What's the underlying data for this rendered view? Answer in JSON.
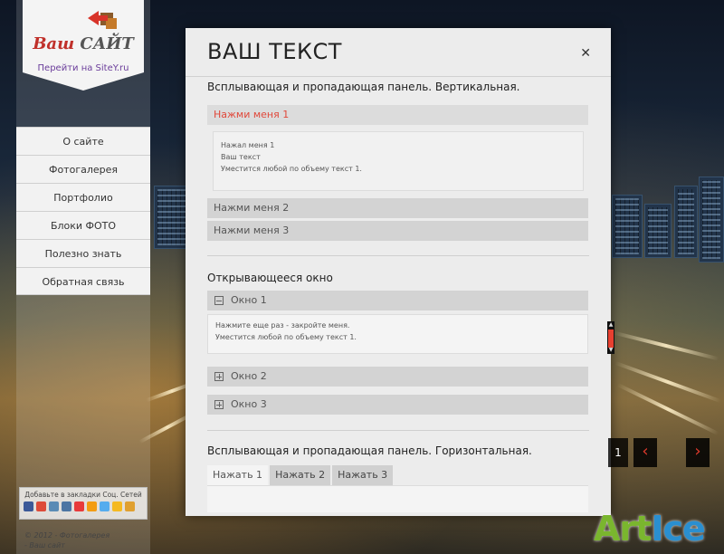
{
  "logo": {
    "title_part1": "Ваш ",
    "title_part2": "САЙТ",
    "link": "Перейти на SiteY.ru"
  },
  "menu": [
    {
      "label": "О сайте"
    },
    {
      "label": "Фотогалерея"
    },
    {
      "label": "Портфолио"
    },
    {
      "label": "Блоки ФОТО"
    },
    {
      "label": "Полезно знать"
    },
    {
      "label": "Обратная связь"
    }
  ],
  "bookmarks": {
    "label": "Добавьте в закладки Соц. Сетей",
    "icons": [
      "facebook-icon",
      "google-icon",
      "livejournal-icon",
      "vkontakte-icon",
      "moimir-icon",
      "odnoklassniki-icon",
      "twitter-icon",
      "yandex-icon",
      "bobrdobr-icon"
    ],
    "icon_colors": [
      "#3b5998",
      "#dd4b39",
      "#5a8bb5",
      "#4c75a3",
      "#e83a3a",
      "#f39c12",
      "#55acee",
      "#f5b921",
      "#e0a030"
    ]
  },
  "footer": {
    "line1": "© 2012 - Фотогалерея",
    "line2": "- Ваш сайт"
  },
  "modal": {
    "title": "ВАШ ТЕКСТ",
    "close": "✕",
    "section1_title": "Всплывающая и пропадающая панель. Вертикальная.",
    "accordion": [
      {
        "label": "Нажми меня 1",
        "active": true
      },
      {
        "label": "Нажми меня 2",
        "active": false
      },
      {
        "label": "Нажми меня 3",
        "active": false
      }
    ],
    "accordion_content": {
      "line1": "Нажал меня 1",
      "line2": "Ваш текст",
      "line3": "Уместится любой по объему текст 1."
    },
    "section2_title": "Открывающееся окно",
    "windows": [
      {
        "label": "Окно 1",
        "open": true
      },
      {
        "label": "Окно 2",
        "open": false
      },
      {
        "label": "Окно 3",
        "open": false
      }
    ],
    "window_content": {
      "line1": "Нажмите еще раз - закройте меня.",
      "line2": "Уместится любой по объему текст 1."
    },
    "section3_title": "Всплывающая и пропадающая панель. Горизонтальная.",
    "tabs": [
      {
        "label": "Нажать 1",
        "active": true
      },
      {
        "label": "Нажать 2",
        "active": false
      },
      {
        "label": "Нажать 3",
        "active": false
      }
    ]
  },
  "slider": {
    "current": "1",
    "prev": "‹",
    "next": "›"
  },
  "watermark": {
    "part1": "Art",
    "part2": "Ice"
  }
}
